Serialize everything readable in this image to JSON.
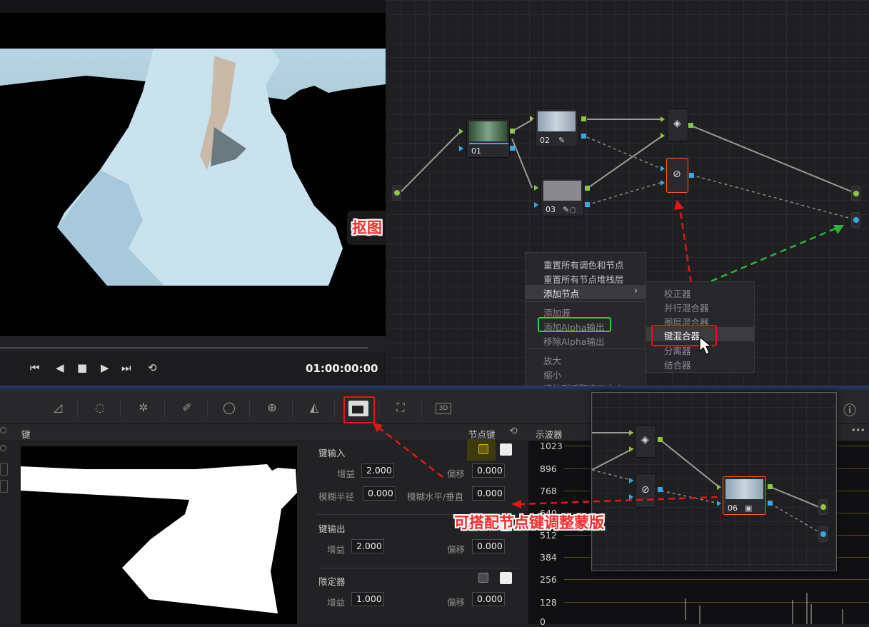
{
  "viewer": {
    "timecode": "01:00:00:00",
    "annotation": "抠图"
  },
  "nodes": {
    "n01": "01",
    "n02": "02",
    "n03": "03",
    "n06": "06"
  },
  "context_menu": {
    "items": [
      "重置所有调色和节点",
      "重置所有节点堆栈层",
      "添加节点",
      "添加源",
      "添加Alpha输出",
      "移除Alpha输出",
      "放大",
      "缩小",
      "缩放到适配窗口大小"
    ],
    "submenu": [
      "校正器",
      "并行混合器",
      "图层混合器",
      "键混合器",
      "分离器",
      "结合器"
    ]
  },
  "key_panel": {
    "title": "键",
    "node_key": "节点键",
    "key_input": "键输入",
    "key_output": "键输出",
    "limiter": "限定器",
    "gain": "增益",
    "offset": "偏移",
    "blur_radius": "模糊半径",
    "blur_hv": "模糊水平/垂直",
    "in_gain": "2.000",
    "in_offset": "0.000",
    "in_blur_radius": "0.000",
    "in_blur_hv": "0.000",
    "out_gain": "2.000",
    "out_offset": "0.000",
    "lim_gain": "1.000",
    "lim_offset": "0.000"
  },
  "scope": {
    "title": "示波器",
    "ticks": [
      "1023",
      "896",
      "768",
      "640",
      "512",
      "384",
      "256",
      "128",
      "0"
    ]
  },
  "annotation_node_key": "可搭配节点键调整蒙版",
  "toolbar": {
    "three_d": "3D",
    "menu_dots": "•••",
    "info": "ⓘ"
  },
  "colors": {
    "green_port": "#8cc63f",
    "blue_port": "#3aa6e6",
    "highlight_red": "#ff2a2a",
    "highlight_green": "#2ecc40"
  }
}
